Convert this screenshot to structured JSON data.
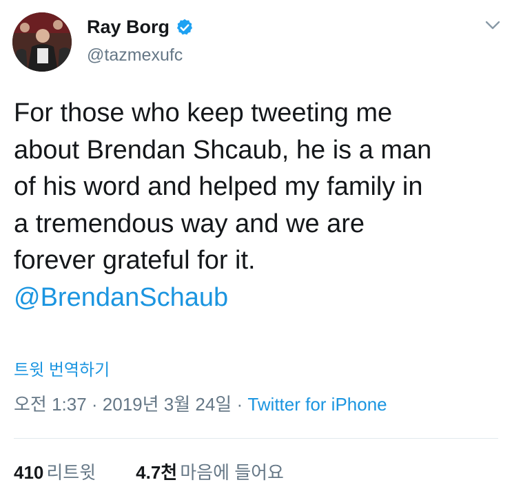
{
  "author": {
    "display_name": "Ray Borg",
    "handle": "@tazmexufc",
    "verified": true,
    "avatar_icon": "profile-photo"
  },
  "tweet": {
    "lines": [
      "For those who keep tweeting me",
      "about Brendan Shcaub, he is a man",
      "of his word and helped my family in",
      "a tremendous way and we are",
      "forever grateful for it."
    ],
    "mention": "@BrendanSchaub"
  },
  "translate_label": "트윗 번역하기",
  "meta": {
    "time": "오전 1:37",
    "separator": " · ",
    "date": "2019년 3월 24일",
    "separator2": " · ",
    "source": "Twitter for iPhone"
  },
  "stats": {
    "retweets_count": "410",
    "retweets_label": "리트윗",
    "likes_count": "4.7천",
    "likes_label": "마음에 들어요"
  },
  "colors": {
    "link": "#1b95e0",
    "muted": "#657786",
    "text": "#14171a",
    "divider": "#e1e8ed"
  },
  "icons": {
    "verified": "verified-badge-icon",
    "menu": "chevron-down-icon"
  }
}
